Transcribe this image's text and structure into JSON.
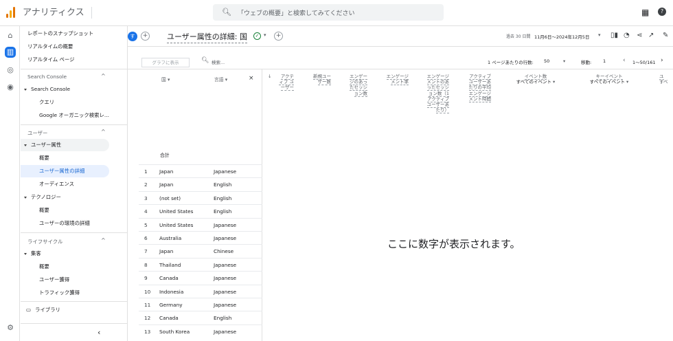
{
  "app": {
    "title": "アナリティクス",
    "search_placeholder": "「ウェブの概要」と検索してみてください"
  },
  "sidebar": {
    "top_items": [
      "レポートのスナップショット",
      "リアルタイムの概要",
      "リアルタイム ページ"
    ],
    "sections": [
      {
        "label": "Search Console",
        "group": "Search Console",
        "items": [
          "クエリ",
          "Google オーガニック検索レ..."
        ]
      },
      {
        "label": "ユーザー",
        "group": "ユーザー属性",
        "items": [
          "概要",
          "ユーザー属性の詳細",
          "オーディエンス"
        ],
        "group2": "テクノロジー",
        "items2": [
          "概要",
          "ユーザーの環境の詳細"
        ]
      },
      {
        "label": "ライフサイクル",
        "group": "集客",
        "items": [
          "概要",
          "ユーザー獲得",
          "トラフィック獲得"
        ]
      }
    ],
    "library": "ライブラリ",
    "collapse": "‹"
  },
  "header": {
    "avatar": "す",
    "title": "ユーザー属性の詳細: 国",
    "date_label": "過去 30 日間",
    "date_range": "11月6日〜2024年12月5日"
  },
  "toolbar": {
    "graph_button": "グラフに表示",
    "search": "検索...",
    "rows_label": "1 ページあたりの行数:",
    "rows_value": "50",
    "goto_label": "移動:",
    "goto_value": "1",
    "pagination": "1〜50/161"
  },
  "table": {
    "dim_headers": {
      "country": "国",
      "language": "言語"
    },
    "total_label": "合計",
    "rows": [
      {
        "n": "1",
        "country": "Japan",
        "lang": "Japanese"
      },
      {
        "n": "2",
        "country": "Japan",
        "lang": "English"
      },
      {
        "n": "3",
        "country": "(not set)",
        "lang": "English"
      },
      {
        "n": "4",
        "country": "United States",
        "lang": "English"
      },
      {
        "n": "5",
        "country": "United States",
        "lang": "Japanese"
      },
      {
        "n": "6",
        "country": "Australia",
        "lang": "Japanese"
      },
      {
        "n": "7",
        "country": "Japan",
        "lang": "Chinese"
      },
      {
        "n": "8",
        "country": "Thailand",
        "lang": "Japanese"
      },
      {
        "n": "9",
        "country": "Canada",
        "lang": "Japanese"
      },
      {
        "n": "10",
        "country": "Indonesia",
        "lang": "Japanese"
      },
      {
        "n": "11",
        "country": "Germany",
        "lang": "Japanese"
      },
      {
        "n": "12",
        "country": "Canada",
        "lang": "English"
      },
      {
        "n": "13",
        "country": "South Korea",
        "lang": "Japanese"
      }
    ],
    "metric_headers": [
      "アクティブ ユーザー",
      "新規ユーザー数",
      "エンゲージのあったセッション数",
      "エンゲージメント率",
      "エンゲージメントのあったセッション数（1 アクティブ ユーザーあたり）",
      "アクティブ ユーザーあたりの平均エンゲージメント時間",
      "イベント数",
      "キーイベント",
      "ユ"
    ],
    "event_filter": "すべてのイベント",
    "placeholder": "ここに数字が表示されます。"
  }
}
